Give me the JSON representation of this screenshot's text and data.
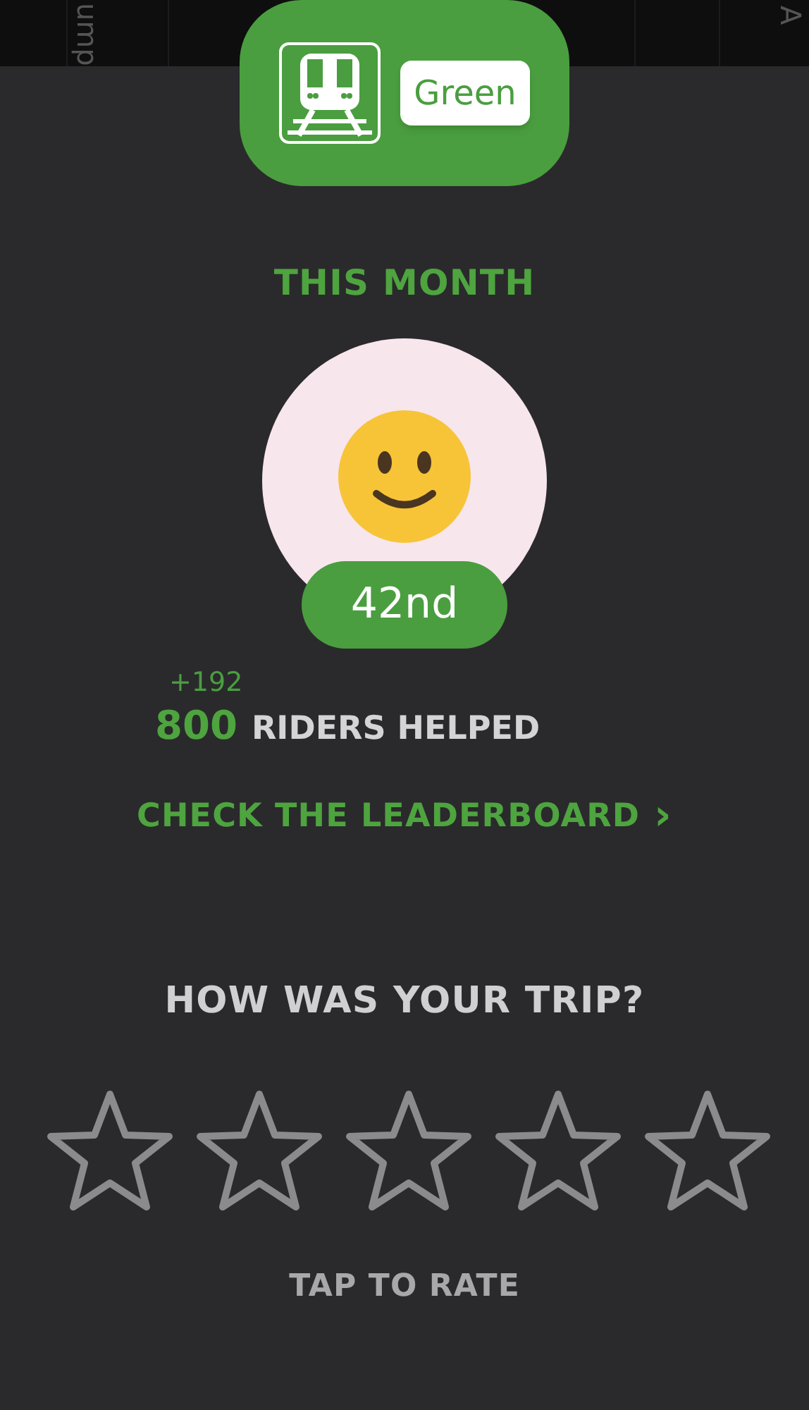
{
  "top_strip": {
    "labels": [
      "ump",
      "A"
    ]
  },
  "line_badge": {
    "line": "Green",
    "color": "#4a9e3f"
  },
  "period": "THIS MONTH",
  "rank": "42nd",
  "stats": {
    "delta": "+192",
    "count": "800",
    "label": "RIDERS HELPED"
  },
  "leaderboard_link": "CHECK THE LEADERBOARD",
  "leaderboard_chevron": "›",
  "rating": {
    "question": "HOW WAS YOUR TRIP?",
    "stars": 0,
    "hint": "TAP TO RATE"
  }
}
